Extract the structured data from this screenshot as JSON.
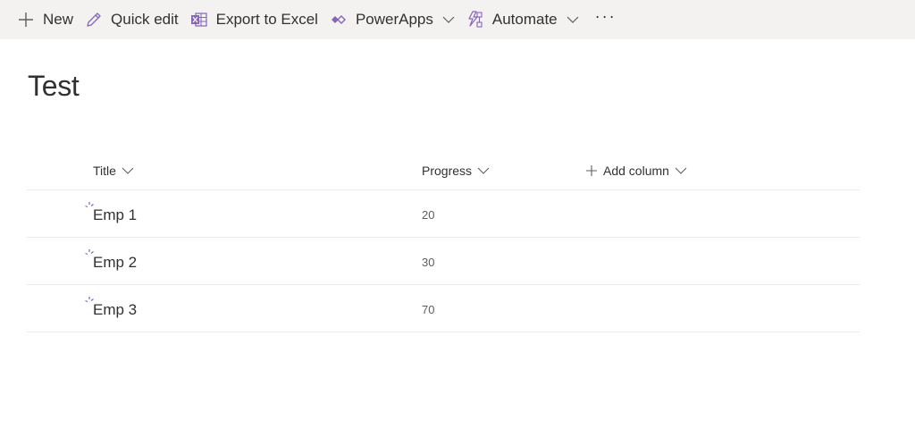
{
  "commandbar": {
    "new_label": "New",
    "quick_edit_label": "Quick edit",
    "export_label": "Export to Excel",
    "powerapps_label": "PowerApps",
    "automate_label": "Automate",
    "more_label": "···"
  },
  "list": {
    "title": "Test",
    "columns": {
      "title": "Title",
      "progress": "Progress",
      "add_column": "Add column"
    },
    "rows": [
      {
        "title": "Emp 1",
        "progress": "20"
      },
      {
        "title": "Emp 2",
        "progress": "30"
      },
      {
        "title": "Emp 3",
        "progress": "70"
      }
    ]
  },
  "colors": {
    "accent": "#8764b8",
    "commandbar_bg": "#f3f2f1",
    "text": "#323130",
    "excel_purple": "#8764b8"
  }
}
